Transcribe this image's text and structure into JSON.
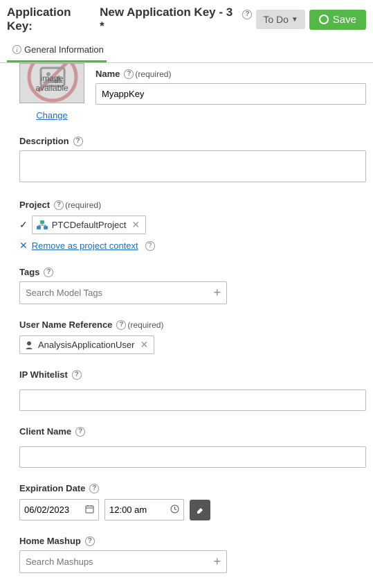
{
  "header": {
    "label": "Application Key:",
    "title": "New Application Key - 3 *",
    "todo": "To Do",
    "save": "Save"
  },
  "tab": {
    "general": "General Information"
  },
  "thumb": {
    "line1": "image",
    "line2": "available",
    "change": "Change"
  },
  "name": {
    "label": "Name",
    "required": "(required)",
    "value": "MyappKey"
  },
  "description": {
    "label": "Description",
    "value": ""
  },
  "project": {
    "label": "Project",
    "required": "(required)",
    "value": "PTCDefaultProject",
    "remove": "Remove as project context"
  },
  "tags": {
    "label": "Tags",
    "placeholder": "Search Model Tags"
  },
  "userRef": {
    "label": "User Name Reference",
    "required": "(required)",
    "value": "AnalysisApplicationUser"
  },
  "ipWhitelist": {
    "label": "IP Whitelist",
    "value": ""
  },
  "clientName": {
    "label": "Client Name",
    "value": ""
  },
  "expiration": {
    "label": "Expiration Date",
    "date": "06/02/2023",
    "time": "12:00 am"
  },
  "homeMashup": {
    "label": "Home Mashup",
    "placeholder": "Search Mashups"
  }
}
